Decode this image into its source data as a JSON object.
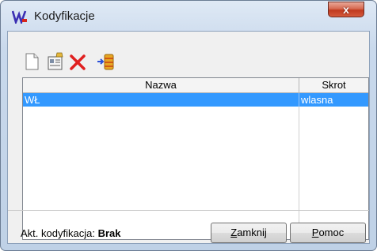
{
  "window": {
    "title": "Kodyfikacje",
    "close_label": "x"
  },
  "toolbar": {
    "buttons": [
      {
        "name": "new-document-icon"
      },
      {
        "name": "edit-card-icon"
      },
      {
        "name": "delete-x-icon"
      },
      {
        "name": "database-import-icon"
      }
    ]
  },
  "table": {
    "columns": [
      "Nazwa",
      "Skrot"
    ],
    "rows": [
      {
        "nazwa": "WŁ",
        "skrot": "wlasna"
      }
    ]
  },
  "status": {
    "label": "Akt. kodyfikacja:",
    "value": "Brak"
  },
  "buttons": {
    "close": {
      "mnemonic": "Z",
      "rest": "amknij"
    },
    "help": {
      "mnemonic": "P",
      "rest": "omoc"
    }
  },
  "colors": {
    "selection": "#3399ff",
    "close_button": "#c9412a",
    "delete_icon": "#e02020"
  }
}
